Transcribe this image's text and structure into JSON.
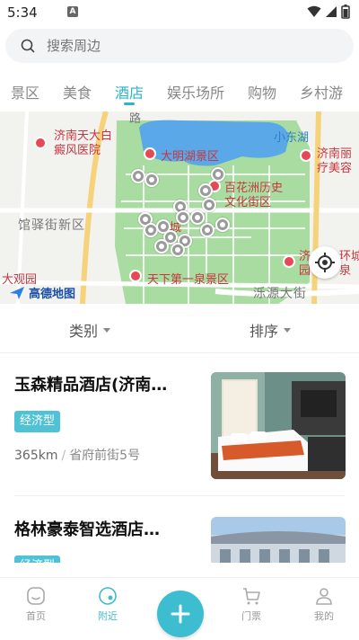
{
  "status_bar": {
    "time": "5:34",
    "notif_letter": "A"
  },
  "search": {
    "placeholder": "搜索周边"
  },
  "categories": [
    {
      "label": "景区"
    },
    {
      "label": "美食"
    },
    {
      "label": "酒店",
      "active": true
    },
    {
      "label": "娱乐场所"
    },
    {
      "label": "购物"
    },
    {
      "label": "乡村游"
    }
  ],
  "map": {
    "labels": {
      "road_top": "路",
      "hospital": "济南天大白\n癜风医院",
      "daming_lake": "大明湖景区",
      "east_lake": "小东湖",
      "beauty": "济南丽",
      "beauty2": "疗美容",
      "baihuazhou": "百花洲历史",
      "baihuazhou2": "文化街区",
      "guanyi": "馆驿街新区",
      "quancheng": "泉城",
      "baotu": "天下第一泉景区",
      "dazhuang": "大观园",
      "ji": "济",
      "yuan": "园",
      "huancheng": "环城",
      "quan": "泉",
      "luoyuan": "泺源大街"
    },
    "logo_text": "高德地图"
  },
  "filter": {
    "category_label": "类别",
    "sort_label": "排序"
  },
  "hotels": [
    {
      "name": "玉森精品酒店(济南…",
      "tag": "经济型",
      "distance": "365km",
      "address": "省府前街5号"
    },
    {
      "name": "格林豪泰智选酒店…",
      "tag": "经济型"
    }
  ],
  "bottom_nav": {
    "home": "首页",
    "nearby": "附近",
    "tickets": "门票",
    "mine": "我的"
  },
  "colors": {
    "accent": "#2bb5c9",
    "tag_bg": "#4fc3d5",
    "fab": "#3dbed0"
  }
}
